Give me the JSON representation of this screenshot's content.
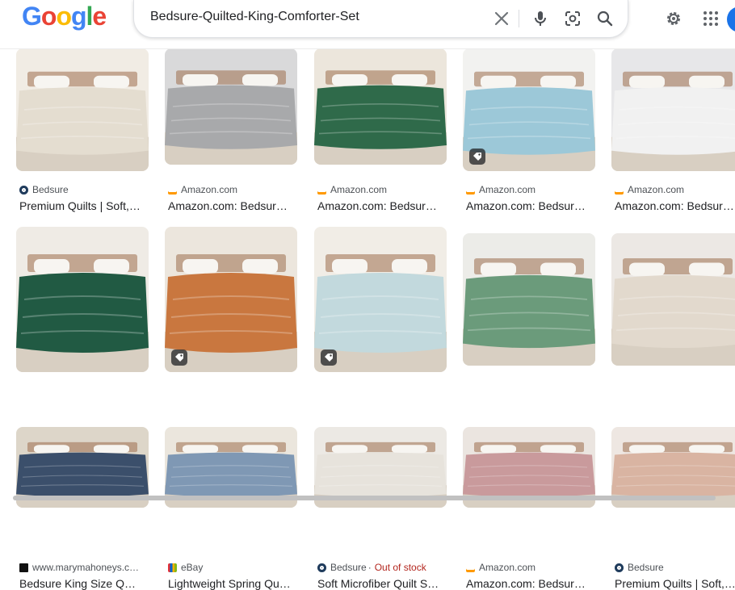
{
  "logo": {
    "letters": [
      "G",
      "o",
      "o",
      "g",
      "l",
      "e"
    ],
    "colors": [
      "#4285F4",
      "#EA4335",
      "#FBBC05",
      "#4285F4",
      "#34A853",
      "#EA4335"
    ]
  },
  "search": {
    "query": "Bedsure-Quilted-King-Comforter-Set"
  },
  "icons": {
    "clear": "close-icon",
    "voice": "microphone-icon",
    "lens": "camera-lens-icon",
    "search": "search-icon",
    "settings": "gear-icon",
    "apps": "apps-grid-icon"
  },
  "results": [
    {
      "source": "Bedsure",
      "title": "Premium Quilts | Soft,…",
      "bed": "#e4ddd0",
      "wall": "#f1ece4",
      "tag": false
    },
    {
      "source": "Amazon.com",
      "title": "Amazon.com: Bedsur…",
      "bed": "#a8a9ab",
      "wall": "#d9d9da",
      "tag": false
    },
    {
      "source": "Amazon.com",
      "title": "Amazon.com: Bedsur…",
      "bed": "#2f6a4a",
      "wall": "#ece6dc",
      "tag": false
    },
    {
      "source": "Amazon.com",
      "title": "Amazon.com: Bedsur…",
      "bed": "#9cc8d8",
      "wall": "#f2f2f0",
      "tag": true
    },
    {
      "source": "Amazon.com",
      "title": "Amazon.com: Bedsur…",
      "bed": "#f1f1f1",
      "wall": "#e7e7e9",
      "tag": false
    },
    {
      "source": "www.marymahoneys.c…",
      "title": "Bedsure King Size Q…",
      "bed": "#215a43",
      "wall": "#efebe5",
      "tag": false
    },
    {
      "source": "eBay",
      "title": "Lightweight Spring Qu…",
      "bed": "#c9773f",
      "wall": "#ece6dd",
      "tag": true
    },
    {
      "source": "Bedsure",
      "status": "Out of stock",
      "title": "Soft Microfiber Quilt S…",
      "bed": "#c2d9dd",
      "wall": "#f1ede6",
      "tag": true
    },
    {
      "source": "Amazon.com",
      "title": "Amazon.com: Bedsur…",
      "bed": "#6b9b7b",
      "wall": "#ecece8",
      "tag": false
    },
    {
      "source": "Bedsure",
      "title": "Premium Quilts | Soft,…",
      "bed": "#e2d9cd",
      "wall": "#ece8e4",
      "tag": false
    },
    {
      "bed": "#3b4f6b",
      "wall": "#ddd6c9"
    },
    {
      "bed": "#7f98b4",
      "wall": "#ebe6dd"
    },
    {
      "bed": "#e7e3dc",
      "wall": "#ece9e4"
    },
    {
      "bed": "#c99a9c",
      "wall": "#ebe5e0"
    },
    {
      "bed": "#d9b4a2",
      "wall": "#eee7e2"
    }
  ]
}
